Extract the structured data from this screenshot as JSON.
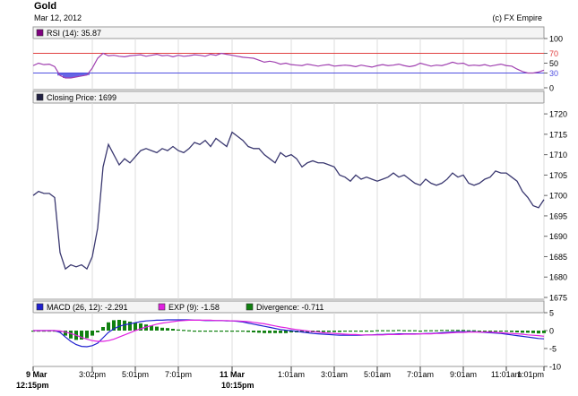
{
  "title": "Gold",
  "date": "Mar 12, 2012",
  "source": "(c) FX Empire",
  "colors": {
    "price_line": "#3a3870",
    "rsi_line": "#a040b0",
    "rsi_fill": "#4a4ae0",
    "rsi_upper_line": "#e04040",
    "rsi_lower_line": "#5050e0",
    "macd_line": "#2020d0",
    "signal_line": "#e020e0",
    "divergence": "#108010",
    "panel_bg": "#f4f4f4",
    "grid": "#dddddd",
    "panel_border": "#999999"
  },
  "chart_data": [
    {
      "type": "line",
      "panel": "rsi",
      "legend": "RSI (14): 35.87",
      "ylim": [
        0,
        100
      ],
      "yticks": [
        "100",
        "70",
        "50",
        "30",
        "0"
      ],
      "thresholds": [
        70,
        30
      ],
      "x": [
        0,
        1,
        2,
        3,
        4,
        5,
        6,
        7,
        8,
        9,
        10,
        11,
        12,
        13,
        14,
        15,
        16,
        17,
        18,
        19,
        20,
        21,
        22,
        23,
        24,
        25,
        26,
        27,
        28,
        29,
        30,
        31,
        32,
        33,
        34,
        35,
        36,
        37,
        38,
        39,
        40,
        41,
        42,
        43,
        44,
        45,
        46,
        47,
        48,
        49,
        50,
        51,
        52,
        53,
        54,
        55,
        56,
        57,
        58,
        59,
        60,
        61,
        62,
        63,
        64,
        65,
        66,
        67,
        68,
        69,
        70,
        71,
        72,
        73,
        74,
        75,
        76,
        77,
        78,
        79,
        80,
        81,
        82,
        83,
        84,
        85,
        86,
        87,
        88,
        89,
        90,
        91,
        92,
        93,
        94,
        95
      ],
      "values": [
        45,
        50,
        47,
        48,
        43,
        25,
        20,
        20,
        22,
        24,
        26,
        40,
        60,
        70,
        65,
        66,
        64,
        63,
        65,
        66,
        67,
        64,
        66,
        68,
        65,
        66,
        63,
        66,
        64,
        65,
        67,
        66,
        64,
        68,
        66,
        70,
        68,
        66,
        64,
        62,
        61,
        60,
        56,
        52,
        54,
        52,
        48,
        50,
        47,
        46,
        45,
        48,
        46,
        44,
        46,
        47,
        44,
        45,
        46,
        45,
        43,
        46,
        44,
        42,
        45,
        47,
        45,
        46,
        48,
        45,
        43,
        45,
        50,
        47,
        44,
        46,
        45,
        48,
        52,
        49,
        50,
        45,
        46,
        45,
        47,
        44,
        46,
        48,
        45,
        44,
        38,
        33,
        30,
        30,
        32,
        35.87
      ],
      "below_30_shaded": true
    },
    {
      "type": "line",
      "panel": "price",
      "legend": "Closing Price: 1699",
      "ylim": [
        1675,
        1722
      ],
      "yticks": [
        "1720",
        "1715",
        "1710",
        "1705",
        "1700",
        "1695",
        "1690",
        "1685",
        "1680",
        "1675"
      ],
      "x": [
        0,
        1,
        2,
        3,
        4,
        5,
        6,
        7,
        8,
        9,
        10,
        11,
        12,
        13,
        14,
        15,
        16,
        17,
        18,
        19,
        20,
        21,
        22,
        23,
        24,
        25,
        26,
        27,
        28,
        29,
        30,
        31,
        32,
        33,
        34,
        35,
        36,
        37,
        38,
        39,
        40,
        41,
        42,
        43,
        44,
        45,
        46,
        47,
        48,
        49,
        50,
        51,
        52,
        53,
        54,
        55,
        56,
        57,
        58,
        59,
        60,
        61,
        62,
        63,
        64,
        65,
        66,
        67,
        68,
        69,
        70,
        71,
        72,
        73,
        74,
        75,
        76,
        77,
        78,
        79,
        80,
        81,
        82,
        83,
        84,
        85,
        86,
        87,
        88,
        89,
        90,
        91,
        92,
        93,
        94,
        95
      ],
      "values": [
        1700,
        1701,
        1700.5,
        1700.5,
        1699.5,
        1686,
        1682,
        1683,
        1682.5,
        1683,
        1682,
        1685,
        1692,
        1707,
        1712.5,
        1710,
        1707.5,
        1709,
        1708,
        1709.5,
        1711,
        1711.5,
        1711,
        1710.5,
        1711.5,
        1711,
        1712,
        1711,
        1710.5,
        1711.5,
        1713,
        1712.5,
        1713.5,
        1712,
        1714,
        1713,
        1712,
        1715.5,
        1714.5,
        1713.5,
        1712,
        1711.5,
        1711.5,
        1710,
        1709,
        1708,
        1710.5,
        1709.5,
        1710,
        1709,
        1707,
        1708,
        1708.5,
        1708,
        1708,
        1707.5,
        1707,
        1705,
        1704.5,
        1703.5,
        1705,
        1704,
        1704.5,
        1704,
        1703.5,
        1704,
        1704.5,
        1705.5,
        1704.5,
        1705,
        1704,
        1703,
        1702.5,
        1704,
        1703,
        1702.5,
        1703,
        1704,
        1705.5,
        1704.5,
        1705,
        1703,
        1702.5,
        1703,
        1704,
        1704.5,
        1706,
        1705.5,
        1705.5,
        1704.5,
        1703.5,
        1701,
        1699.5,
        1697.5,
        1697,
        1699
      ]
    },
    {
      "type": "line",
      "panel": "macd",
      "legend": {
        "macd": "MACD (26, 12): -2.291",
        "signal": "EXP (9): -1.58",
        "divergence": "Divergence: -0.711"
      },
      "ylim": [
        -10,
        5
      ],
      "yticks": [
        "5",
        "0",
        "-5",
        "-10"
      ],
      "x": [
        0,
        1,
        2,
        3,
        4,
        5,
        6,
        7,
        8,
        9,
        10,
        11,
        12,
        13,
        14,
        15,
        16,
        17,
        18,
        19,
        20,
        21,
        22,
        23,
        24,
        25,
        26,
        27,
        28,
        29,
        30,
        31,
        32,
        33,
        34,
        35,
        36,
        37,
        38,
        39,
        40,
        41,
        42,
        43,
        44,
        45,
        46,
        47,
        48,
        49,
        50,
        51,
        52,
        53,
        54,
        55,
        56,
        57,
        58,
        59,
        60,
        61,
        62,
        63,
        64,
        65,
        66,
        67,
        68,
        69,
        70,
        71,
        72,
        73,
        74,
        75,
        76,
        77,
        78,
        79,
        80,
        81,
        82,
        83,
        84,
        85,
        86,
        87,
        88,
        89,
        90,
        91,
        92,
        93,
        94,
        95
      ],
      "series": [
        {
          "name": "MACD (26, 12): -2.291",
          "values": [
            0,
            0,
            0,
            0,
            0,
            -0.5,
            -1.8,
            -3,
            -3.9,
            -4.4,
            -4.5,
            -4.2,
            -3.5,
            -2,
            -0.5,
            0.5,
            1.2,
            1.6,
            1.9,
            2.2,
            2.5,
            2.7,
            2.8,
            2.9,
            2.9,
            3.0,
            3.0,
            3.0,
            3.0,
            3.0,
            2.9,
            2.9,
            2.8,
            2.8,
            2.8,
            2.8,
            2.7,
            2.7,
            2.6,
            2.4,
            2.1,
            1.8,
            1.5,
            1.2,
            0.9,
            0.6,
            0.3,
            0.1,
            0,
            -0.2,
            -0.4,
            -0.6,
            -0.8,
            -0.9,
            -1.0,
            -1.1,
            -1.2,
            -1.3,
            -1.3,
            -1.3,
            -1.3,
            -1.3,
            -1.2,
            -1.2,
            -1.1,
            -1.1,
            -1.0,
            -1.0,
            -0.9,
            -0.9,
            -0.9,
            -0.9,
            -0.9,
            -0.8,
            -0.8,
            -0.7,
            -0.6,
            -0.5,
            -0.4,
            -0.3,
            -0.3,
            -0.3,
            -0.3,
            -0.4,
            -0.5,
            -0.6,
            -0.7,
            -0.8,
            -1.0,
            -1.2,
            -1.4,
            -1.6,
            -1.8,
            -2.0,
            -2.2,
            -2.291
          ]
        },
        {
          "name": "EXP (9): -1.58",
          "values": [
            0,
            0,
            0,
            0,
            0,
            -0.1,
            -0.4,
            -0.8,
            -1.3,
            -1.9,
            -2.4,
            -2.8,
            -3.0,
            -3.0,
            -2.8,
            -2.4,
            -1.8,
            -1.2,
            -0.6,
            0,
            0.5,
            1.0,
            1.4,
            1.8,
            2.1,
            2.3,
            2.5,
            2.7,
            2.8,
            2.9,
            2.9,
            2.9,
            2.9,
            2.9,
            2.8,
            2.8,
            2.8,
            2.7,
            2.7,
            2.6,
            2.5,
            2.3,
            2.1,
            1.9,
            1.6,
            1.3,
            1.0,
            0.8,
            0.5,
            0.3,
            0.1,
            -0.1,
            -0.3,
            -0.4,
            -0.6,
            -0.7,
            -0.8,
            -0.9,
            -1.0,
            -1.1,
            -1.1,
            -1.2,
            -1.2,
            -1.2,
            -1.2,
            -1.2,
            -1.1,
            -1.1,
            -1.1,
            -1.0,
            -1.0,
            -1.0,
            -0.9,
            -0.9,
            -0.9,
            -0.8,
            -0.8,
            -0.7,
            -0.6,
            -0.5,
            -0.5,
            -0.4,
            -0.4,
            -0.4,
            -0.4,
            -0.4,
            -0.5,
            -0.6,
            -0.7,
            -0.8,
            -0.9,
            -1.0,
            -1.2,
            -1.3,
            -1.4,
            -1.58
          ]
        }
      ],
      "divergence_values": [
        0,
        0,
        0,
        0,
        0,
        -0.4,
        -1.4,
        -2.2,
        -2.6,
        -2.5,
        -2.1,
        -1.4,
        -0.5,
        1.0,
        2.3,
        2.9,
        3.0,
        2.8,
        2.5,
        2.2,
        2.0,
        1.7,
        1.4,
        1.1,
        0.8,
        0.7,
        0.5,
        0.3,
        0.2,
        0.1,
        0,
        0,
        -0.1,
        -0.1,
        0,
        0,
        -0.1,
        0,
        -0.1,
        -0.2,
        -0.4,
        -0.5,
        -0.6,
        -0.7,
        -0.7,
        -0.7,
        -0.7,
        -0.7,
        -0.5,
        -0.5,
        -0.5,
        -0.5,
        -0.5,
        -0.5,
        -0.4,
        -0.4,
        -0.4,
        -0.4,
        -0.3,
        -0.2,
        -0.2,
        -0.1,
        0,
        0,
        0.1,
        0.1,
        0.1,
        0.1,
        0.2,
        0.1,
        0.1,
        0.1,
        0,
        0.1,
        0.1,
        0.1,
        0.2,
        0.2,
        0.2,
        0.2,
        0.2,
        0.1,
        0.1,
        0,
        -0.1,
        -0.2,
        -0.2,
        -0.2,
        -0.3,
        -0.4,
        -0.5,
        -0.6,
        -0.6,
        -0.7,
        -0.8,
        -0.711
      ]
    }
  ],
  "x_axis": {
    "labels": [
      {
        "index": 0,
        "line1": "9 Mar",
        "line2": "12:15pm"
      },
      {
        "index": 11,
        "line1": "3:02pm",
        "line2": ""
      },
      {
        "index": 19,
        "line1": "5:01pm",
        "line2": ""
      },
      {
        "index": 27,
        "line1": "7:01pm",
        "line2": ""
      },
      {
        "index": 37,
        "line1": "11 Mar",
        "line2": "10:15pm"
      },
      {
        "index": 48,
        "line1": "1:01am",
        "line2": ""
      },
      {
        "index": 56,
        "line1": "3:01am",
        "line2": ""
      },
      {
        "index": 64,
        "line1": "5:01am",
        "line2": ""
      },
      {
        "index": 72,
        "line1": "7:01am",
        "line2": ""
      },
      {
        "index": 80,
        "line1": "9:01am",
        "line2": ""
      },
      {
        "index": 88,
        "line1": "11:01am",
        "line2": ""
      },
      {
        "index": 95,
        "line1": "1:01pm",
        "line2": ""
      }
    ]
  }
}
